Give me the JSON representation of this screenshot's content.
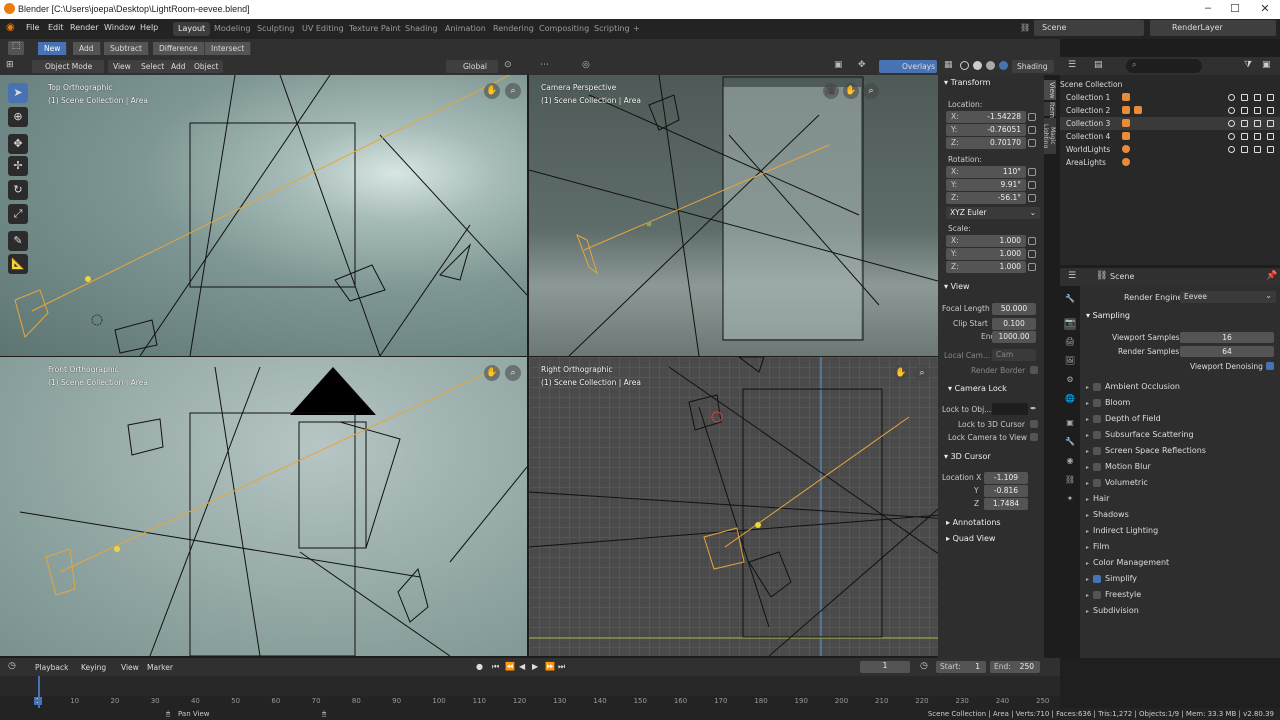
{
  "window": {
    "title": "Blender [C:\\Users\\joepa\\Desktop\\LightRoom-eevee.blend]"
  },
  "menu": [
    "File",
    "Edit",
    "Render",
    "Window",
    "Help"
  ],
  "workspaces": {
    "tabs": [
      "Layout",
      "Modeling",
      "Sculpting",
      "UV Editing",
      "Texture Paint",
      "Shading",
      "Animation",
      "Rendering",
      "Compositing",
      "Scripting"
    ],
    "active": "Layout",
    "add": "+"
  },
  "scene": {
    "name": "Scene",
    "view_layer": "RenderLayer"
  },
  "toolbar": {
    "modes": [
      "New",
      "Add",
      "Subtract",
      "Difference",
      "Intersect"
    ],
    "active": "New"
  },
  "viewport_header": {
    "mode": "Object Mode",
    "menus": [
      "View",
      "Select",
      "Add",
      "Object"
    ],
    "transform_orientation": "Global",
    "overlays": "Overlays",
    "shading": "Shading"
  },
  "viewports": [
    {
      "label": "Top Orthographic",
      "sub": "(1) Scene Collection | Area"
    },
    {
      "label": "Camera Perspective",
      "sub": "(1) Scene Collection | Area"
    },
    {
      "label": "Front Orthographic",
      "sub": "(1) Scene Collection | Area"
    },
    {
      "label": "Right Orthographic",
      "sub": "(1) Scene Collection | Area"
    }
  ],
  "npanel": {
    "transform_title": "Transform",
    "location_label": "Location:",
    "location": {
      "x": "-1.54228",
      "y": "-0.76051",
      "z": "0.70170"
    },
    "rotation_label": "Rotation:",
    "rotation": {
      "x": "110°",
      "y": "9.91°",
      "z": "-56.1°"
    },
    "rotation_mode": "XYZ Euler",
    "scale_label": "Scale:",
    "scale": {
      "x": "1.000",
      "y": "1.000",
      "z": "1.000"
    },
    "axes": {
      "x": "X:",
      "y": "Y:",
      "z": "Z:"
    },
    "view_title": "View",
    "focal_length_label": "Focal Length",
    "focal_length": "50.000",
    "clip_start_label": "Clip Start",
    "clip_start": "0.100",
    "clip_end_label": "End",
    "clip_end": "1000.00",
    "local_camera_label": "Local Cam...",
    "local_camera": "Cam",
    "render_border": "Render Border",
    "camera_lock_title": "Camera Lock",
    "lock_to_object": "Lock to Obj...",
    "lock_to_cursor": "Lock to 3D Cursor",
    "lock_camera_to_view": "Lock Camera to View",
    "cursor_title": "3D Cursor",
    "cursor_location_label": "Location X",
    "cursor_y_label": "Y",
    "cursor_z_label": "Z",
    "cursor": {
      "x": "-1.109",
      "y": "-0.816",
      "z": "1.7484"
    },
    "annotations_title": "Annotations",
    "quad_view_title": "Quad View",
    "tabs": [
      "View",
      "Item",
      "Magic Lighting"
    ]
  },
  "outliner": {
    "root": "Scene Collection",
    "items": [
      "Collection 1",
      "Collection 2",
      "Collection 3",
      "Collection 4",
      "WorldLights",
      "AreaLights"
    ]
  },
  "properties": {
    "context": "Scene",
    "render_engine_label": "Render Engine",
    "render_engine": "Eevee",
    "sampling_title": "Sampling",
    "viewport_samples_label": "Viewport Samples",
    "viewport_samples": "16",
    "render_samples_label": "Render Samples",
    "render_samples": "64",
    "viewport_denoising": "Viewport Denoising",
    "panels": [
      {
        "label": "Ambient Occlusion",
        "checkbox": true,
        "checked": false
      },
      {
        "label": "Bloom",
        "checkbox": true,
        "checked": false
      },
      {
        "label": "Depth of Field",
        "checkbox": true,
        "checked": false
      },
      {
        "label": "Subsurface Scattering",
        "checkbox": true,
        "checked": false
      },
      {
        "label": "Screen Space Reflections",
        "checkbox": true,
        "checked": false
      },
      {
        "label": "Motion Blur",
        "checkbox": true,
        "checked": false
      },
      {
        "label": "Volumetric",
        "checkbox": true,
        "checked": false
      },
      {
        "label": "Hair",
        "checkbox": false,
        "checked": false
      },
      {
        "label": "Shadows",
        "checkbox": false,
        "checked": false
      },
      {
        "label": "Indirect Lighting",
        "checkbox": false,
        "checked": false
      },
      {
        "label": "Film",
        "checkbox": false,
        "checked": false
      },
      {
        "label": "Color Management",
        "checkbox": false,
        "checked": false
      },
      {
        "label": "Simplify",
        "checkbox": true,
        "checked": true
      },
      {
        "label": "Freestyle",
        "checkbox": true,
        "checked": false
      },
      {
        "label": "Subdivision",
        "checkbox": false,
        "checked": false
      }
    ]
  },
  "timeline": {
    "menus": [
      "Playback",
      "Keying",
      "View",
      "Marker"
    ],
    "current_frame": "1",
    "start_label": "Start:",
    "start": "1",
    "end_label": "End:",
    "end": "250",
    "ruler": [
      "1",
      "10",
      "20",
      "30",
      "40",
      "50",
      "60",
      "70",
      "80",
      "90",
      "100",
      "110",
      "120",
      "130",
      "140",
      "150",
      "160",
      "170",
      "180",
      "190",
      "200",
      "210",
      "220",
      "230",
      "240",
      "250"
    ]
  },
  "status": {
    "hint": "Pan View",
    "stats": "Scene Collection | Area | Verts:710 | Faces:636 | Tris:1,272 | Objects:1/9 | Mem: 33.3 MB | v2.80.39"
  },
  "colors": {
    "accent": "#4772b3",
    "active_object": "#e88b3c",
    "selection_yellow": "#ecd63f"
  }
}
